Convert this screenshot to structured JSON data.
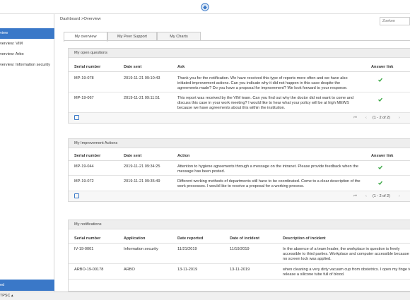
{
  "sidebar": {
    "items": [
      {
        "label": "view",
        "active": true
      },
      {
        "label": "verview: VIM"
      },
      {
        "label": "verview: Arbo"
      },
      {
        "label": "verview: Information security"
      }
    ],
    "bottom_label": "ed"
  },
  "header": {
    "breadcrumb": "Dashboard >Overview",
    "search_placeholder": "Zoeken"
  },
  "tabs": [
    {
      "label": "My overview",
      "active": true
    },
    {
      "label": "My Peer Support"
    },
    {
      "label": "My Charts"
    }
  ],
  "questions": {
    "title": "My open questions",
    "columns": [
      "Serial number",
      "Date sent",
      "Ask",
      "Answer link"
    ],
    "rows": [
      {
        "serial": "MP-19-078",
        "date": "2019-11-21 09:10:43",
        "text": "Thank you for the notification. We have received this type of reports more often and we have also initiated improvement actions. Can you indicate why it did not happen in this case despite the agreements made? Do you have a proposal for improvement? We look forward to your response."
      },
      {
        "serial": "MP-19-067",
        "date": "2019-11-21 09:11:51",
        "text": "This report was received by the VIM team. Can you find out why the doctor did not want to come and discuss this case in your work meeting? I would like to hear what your policy will be at high MEWS because we have agreements about this within the institution."
      }
    ],
    "page_info": "(1 - 2 of 2)"
  },
  "improvements": {
    "title": "My Improvement Actions",
    "columns": [
      "Serial number",
      "Date sent",
      "Action",
      "Answer link"
    ],
    "rows": [
      {
        "serial": "MP-19-044",
        "date": "2019-11-21 09:34:25",
        "text": "Attention to hygiene agreements through a message on the intranet. Please provide feedback when the message has been posted."
      },
      {
        "serial": "MP-19-072",
        "date": "2019-11-21 09:35:49",
        "text": "Different working methods of departments still have to be coordinated. Come to a clear description of the work processes. I would like to receive a proposal for a working process."
      }
    ],
    "page_info": "(1 - 2 of 2)"
  },
  "notifications": {
    "title": "My notifications",
    "columns": [
      "Serial number",
      "Application",
      "Date reported",
      "Date of incident",
      "Description of incident"
    ],
    "rows": [
      {
        "serial": "IV-19-0001",
        "app": "Information security",
        "reported": "11/21/2019",
        "incident": "11/19/2019",
        "text": "In the absence of a team leader, the workplace in question is freely accessible to third parties. Workplace and computer accessible because no screen lock was applied."
      },
      {
        "serial": "ARBO-19-00178",
        "app": "ARBO",
        "reported": "13-11-2019",
        "incident": "13-11-2019",
        "text": "when cleaning a very dirty vacuum cup from obstetrics. I open my finge to release a silicone tube full of blood."
      }
    ]
  },
  "statusbar": {
    "text": "TPSC ▴"
  },
  "colors": {
    "accent": "#3a78c8",
    "check": "#3aa845"
  }
}
